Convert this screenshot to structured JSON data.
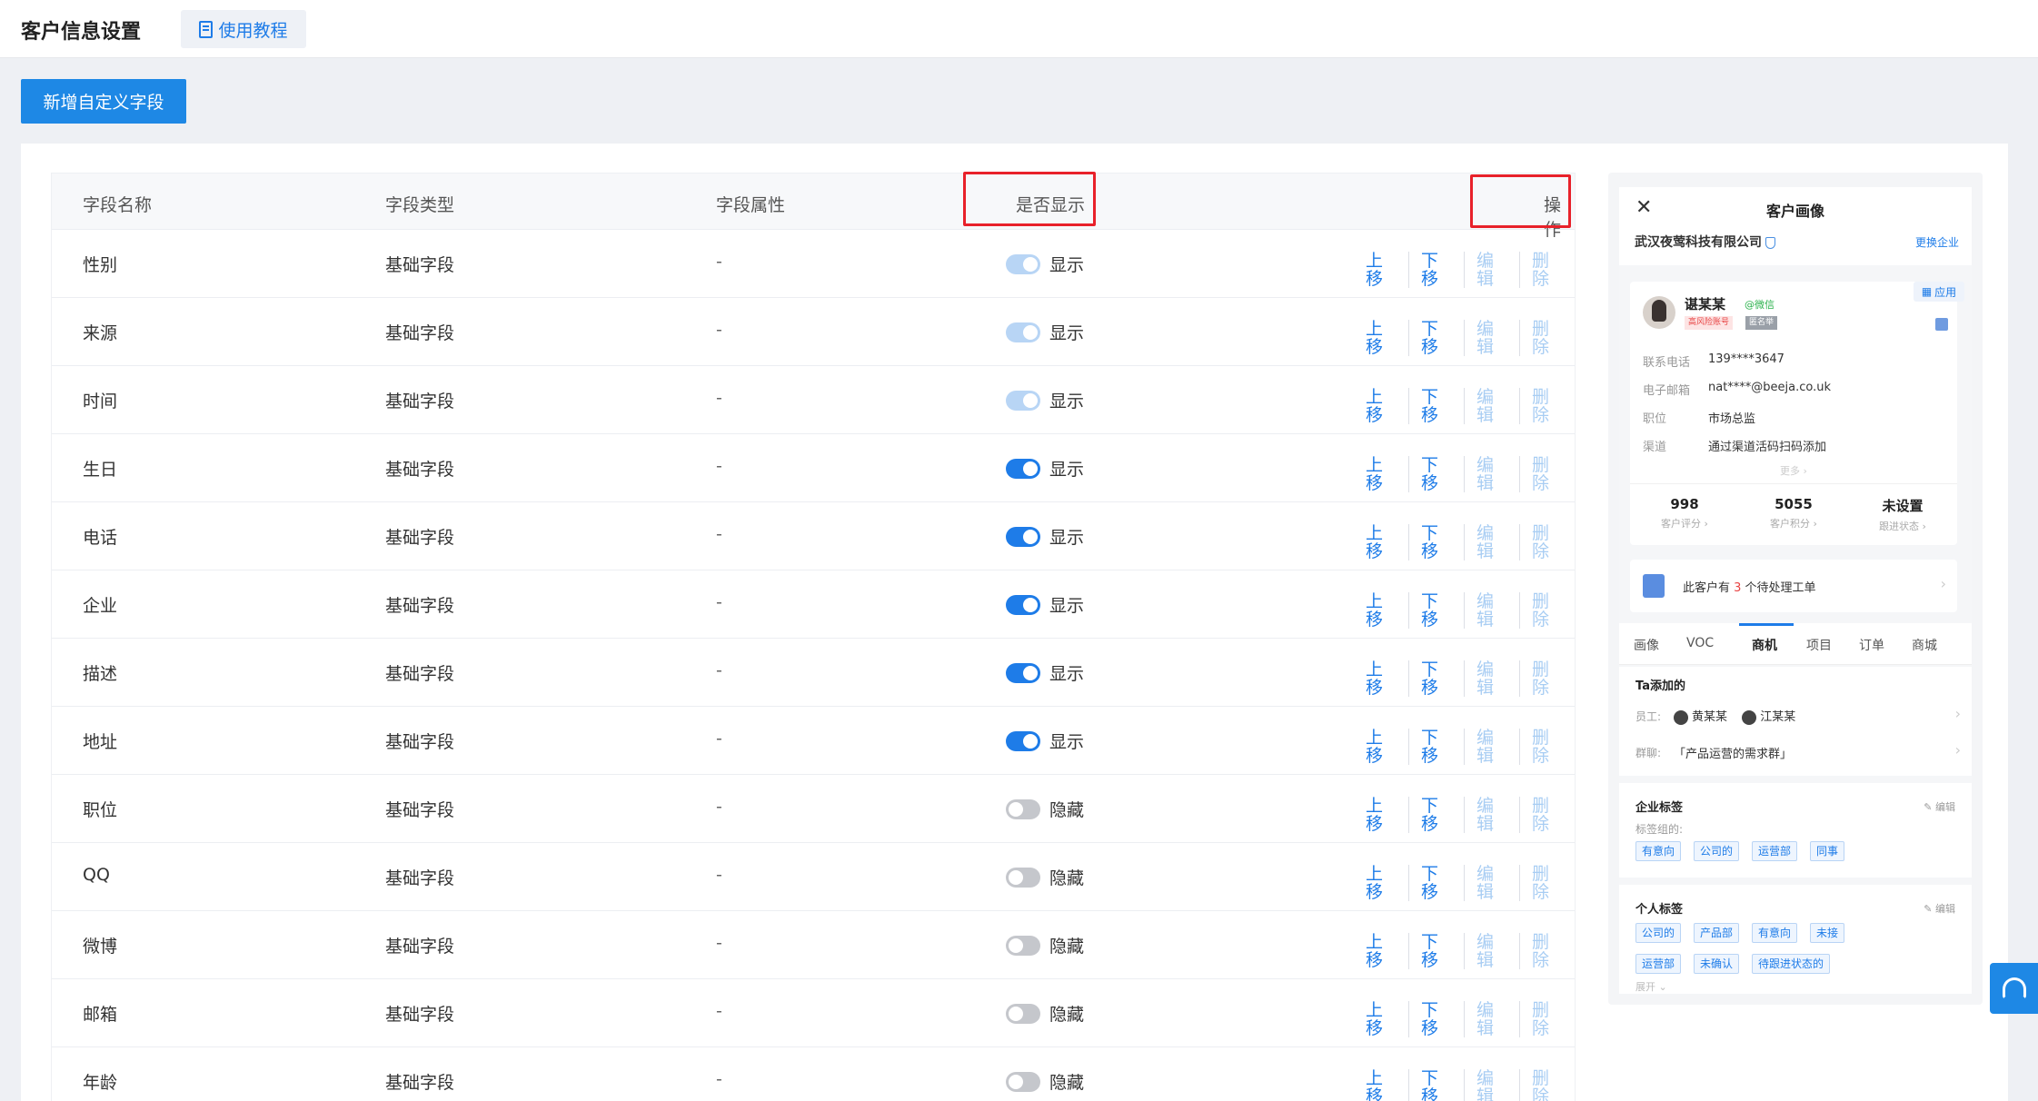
{
  "header": {
    "title": "客户信息设置",
    "tutorial_label": "使用教程"
  },
  "toolbar": {
    "add_label": "新增自定义字段"
  },
  "table": {
    "columns": {
      "name": "字段名称",
      "type": "字段类型",
      "attr": "字段属性",
      "display": "是否显示",
      "ops": "操作"
    },
    "ops": {
      "up": "上移",
      "down": "下移",
      "edit": "编辑",
      "delete": "删除"
    },
    "rows": [
      {
        "name": "性别",
        "type": "基础字段",
        "attr": "-",
        "display": "显示",
        "switch": "disabled"
      },
      {
        "name": "来源",
        "type": "基础字段",
        "attr": "-",
        "display": "显示",
        "switch": "disabled"
      },
      {
        "name": "时间",
        "type": "基础字段",
        "attr": "-",
        "display": "显示",
        "switch": "disabled"
      },
      {
        "name": "生日",
        "type": "基础字段",
        "attr": "-",
        "display": "显示",
        "switch": "on"
      },
      {
        "name": "电话",
        "type": "基础字段",
        "attr": "-",
        "display": "显示",
        "switch": "on"
      },
      {
        "name": "企业",
        "type": "基础字段",
        "attr": "-",
        "display": "显示",
        "switch": "on"
      },
      {
        "name": "描述",
        "type": "基础字段",
        "attr": "-",
        "display": "显示",
        "switch": "on"
      },
      {
        "name": "地址",
        "type": "基础字段",
        "attr": "-",
        "display": "显示",
        "switch": "on"
      },
      {
        "name": "职位",
        "type": "基础字段",
        "attr": "-",
        "display": "隐藏",
        "switch": "off"
      },
      {
        "name": "QQ",
        "type": "基础字段",
        "attr": "-",
        "display": "隐藏",
        "switch": "off"
      },
      {
        "name": "微博",
        "type": "基础字段",
        "attr": "-",
        "display": "隐藏",
        "switch": "off"
      },
      {
        "name": "邮箱",
        "type": "基础字段",
        "attr": "-",
        "display": "隐藏",
        "switch": "off"
      },
      {
        "name": "年龄",
        "type": "基础字段",
        "attr": "-",
        "display": "隐藏",
        "switch": "off"
      }
    ]
  },
  "preview": {
    "title": "客户画像",
    "company": "武汉夜莺科技有限公司",
    "switch_company": "更换企业",
    "app_label": "应用",
    "customer": {
      "name": "谌某某",
      "wechat": "@微信",
      "risk_tag": "高风险账号",
      "anon_tag": "匿名举",
      "fields": [
        {
          "label": "联系电话",
          "value": "139****3647"
        },
        {
          "label": "电子邮箱",
          "value": "nat****@beeja.co.uk"
        },
        {
          "label": "职位",
          "value": "市场总监"
        },
        {
          "label": "渠道",
          "value": "通过渠道活码扫码添加"
        }
      ],
      "more": "更多 ›"
    },
    "stats": [
      {
        "num": "998",
        "label": "客户评分 ›"
      },
      {
        "num": "5055",
        "label": "客户积分 ›"
      },
      {
        "num": "未设置",
        "label": "跟进状态 ›"
      }
    ],
    "order": {
      "prefix": "此客户有 ",
      "count": "3",
      "suffix": " 个待处理工单"
    },
    "tabs": [
      "画像",
      "VOC",
      "商机",
      "项目",
      "订单",
      "商城"
    ],
    "added_by": {
      "title": "Ta添加的",
      "staff_label": "员工:",
      "staff": [
        "黄某某",
        "江某某"
      ],
      "group_label": "群聊:",
      "group": "「产品运营的需求群」"
    },
    "corp_tags": {
      "title": "企业标签",
      "edit": "编辑",
      "group_label": "标签组的:",
      "tags": [
        "有意向",
        "公司的",
        "运营部",
        "同事"
      ]
    },
    "personal_tags": {
      "title": "个人标签",
      "edit": "编辑",
      "tags": [
        "公司的",
        "产品部",
        "有意向",
        "未接",
        "运营部",
        "未确认",
        "待跟进状态的"
      ],
      "expand": "展开 ⌄"
    }
  },
  "colors": {
    "primary": "#1e88e5",
    "link": "#1e7ce8",
    "highlight": "#e8212a",
    "switch_off": "#c5c7cc"
  }
}
